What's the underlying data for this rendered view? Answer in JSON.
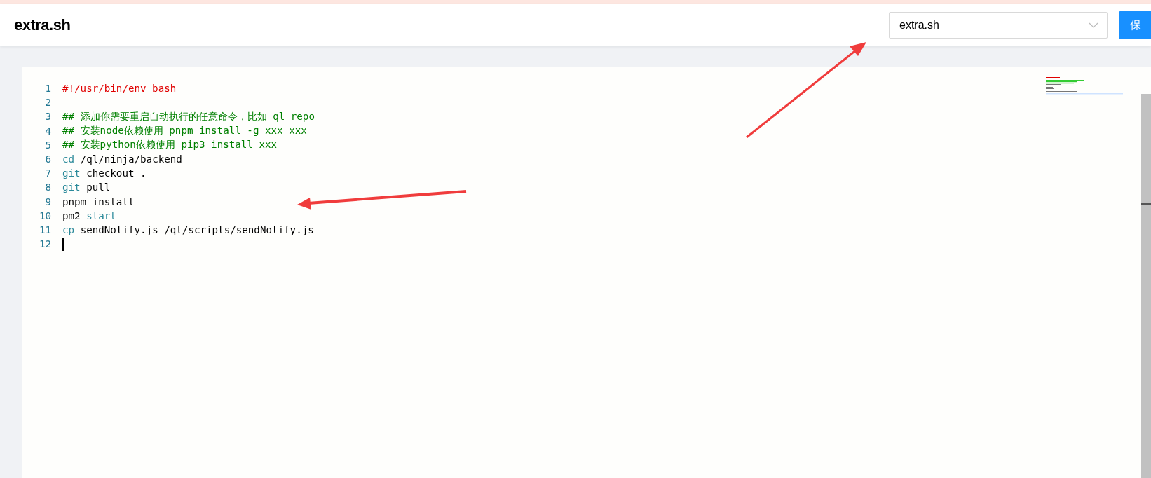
{
  "header": {
    "title": "extra.sh",
    "file_select": {
      "value": "extra.sh"
    },
    "save_button": {
      "label": "保"
    }
  },
  "editor": {
    "lines": [
      {
        "number": "1",
        "tokens": [
          {
            "text": "#!/usr/bin/env bash",
            "kind": "shebang"
          }
        ]
      },
      {
        "number": "2"
      },
      {
        "number": "3",
        "tokens": [
          {
            "text": "## 添加你需要重启自动执行的任意命令，比如 ql repo",
            "kind": "comment"
          }
        ]
      },
      {
        "number": "4",
        "tokens": [
          {
            "text": "## 安装node依赖使用 pnpm install -g xxx xxx",
            "kind": "comment"
          }
        ]
      },
      {
        "number": "5",
        "tokens": [
          {
            "text": "## 安装python依赖使用 pip3 install xxx",
            "kind": "comment"
          }
        ]
      },
      {
        "number": "6",
        "tokens": [
          {
            "text": "cd",
            "kind": "keyword"
          },
          {
            "text": " /ql/ninja/backend",
            "kind": "plain"
          }
        ]
      },
      {
        "number": "7",
        "tokens": [
          {
            "text": "git",
            "kind": "keyword"
          },
          {
            "text": " checkout .",
            "kind": "plain"
          }
        ]
      },
      {
        "number": "8",
        "tokens": [
          {
            "text": "git",
            "kind": "keyword"
          },
          {
            "text": " pull",
            "kind": "plain"
          }
        ]
      },
      {
        "number": "9",
        "tokens": [
          {
            "text": "pnpm install",
            "kind": "plain"
          }
        ]
      },
      {
        "number": "10",
        "tokens": [
          {
            "text": "pm2 ",
            "kind": "plain"
          },
          {
            "text": "start",
            "kind": "keyword"
          }
        ]
      },
      {
        "number": "11",
        "tokens": [
          {
            "text": "cp",
            "kind": "keyword"
          },
          {
            "text": " sendNotify.js /ql/scripts/sendNotify.js",
            "kind": "plain"
          }
        ]
      },
      {
        "number": "12",
        "cursor": true
      }
    ]
  }
}
